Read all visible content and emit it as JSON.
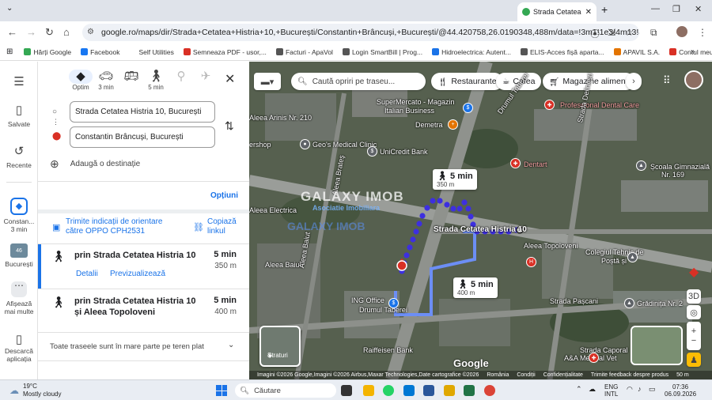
{
  "browser": {
    "tab_title": "Strada Cetatea Hi",
    "url": "google.ro/maps/dir/Strada+Cetatea+Histria+10,+București/Constantin+Brâncuși,+București/@44.420758,26.0190348,488m/data=!3m1!1e3!4m13!4",
    "bookmarks": [
      {
        "label": "Hărți Google",
        "color": "#34a853"
      },
      {
        "label": "Facebook",
        "color": "#1877f2"
      },
      {
        "label": "Self Utilities",
        "color": "#ffffff"
      },
      {
        "label": "Semneaza PDF - usor,...",
        "color": "#d93025"
      },
      {
        "label": "Facturi - ApaVol",
        "color": "#555555"
      },
      {
        "label": "Login SmartBill | Prog...",
        "color": "#555555"
      },
      {
        "label": "Hidroelectrica: Autent...",
        "color": "#1a73e8"
      },
      {
        "label": "ELIS-Acces fișă aparta...",
        "color": "#555555"
      },
      {
        "label": "APAVIL S.A.",
        "color": "#e37400"
      },
      {
        "label": "Contul meu",
        "color": "#d93025"
      }
    ]
  },
  "rail": {
    "menu_icon": "menu-icon",
    "saved": "Salvate",
    "recent": "Recente",
    "current_label": "Constan...",
    "current_time": "3 min",
    "city_thumb_num": "46",
    "city": "București",
    "more": "Afișează mai multe",
    "download": "Descarcă aplicația"
  },
  "modes": {
    "best": "Optim",
    "car_time": "3 min",
    "walk_time": "5 min"
  },
  "directions": {
    "origin": "Strada Cetatea Histria 10, București",
    "destination": "Constantin Brâncuși, București",
    "add_destination": "Adaugă o destinație",
    "options": "Opțiuni",
    "send_to_phone": "Trimite indicații de orientare către OPPO CPH2531",
    "copy_link": "Copiază linkul",
    "routes": [
      {
        "name": "prin Strada Cetatea Histria 10",
        "time": "5 min",
        "distance": "350 m",
        "details": "Detalii",
        "preview": "Previzualizează"
      },
      {
        "name": "prin Strada Cetatea Histria 10 și Aleea Topoloveni",
        "time": "5 min",
        "distance": "400 m"
      }
    ],
    "all_routes_note": "Toate traseele sunt în mare parte pe teren plat"
  },
  "map": {
    "search_placeholder": "Caută opriri pe traseu...",
    "chips": [
      "Restaurante",
      "Cafea",
      "Magazine alimentar"
    ],
    "callout1": {
      "time": "5 min",
      "dist": "350 m"
    },
    "callout2": {
      "time": "5 min",
      "dist": "400 m"
    },
    "labels": [
      "SuperMercato - Magazin",
      "Italian Business",
      "Demetra",
      "Professional Dental Care",
      "Aleea Arinis Nr. 210",
      "Geo's Medical Clinic",
      "UniCredit Bank",
      "Drumul Taberei",
      "Strada Delineşti",
      "Dentart",
      "Școala Gimnazială",
      "Nr. 169",
      "Aleea Electrica",
      "Strada Cetatea Histria 10",
      "Aleea Topoloveni",
      "Colegiul Tehnic de",
      "Poștă și",
      "Aleea Baiut",
      "ING Office",
      "Drumul Taberei",
      "Strada Pașcani",
      "Grădinița Nr. 2",
      "Raiffeisen Bank",
      "A&A Medical Vet",
      "Strada Caporal",
      "Straturi",
      "3D",
      "ershop",
      "Aleea Baiut",
      "Aleea Brateş"
    ],
    "watermark": "GALAXY IMOB",
    "watermark_sub": "Asociatie Imobiliara",
    "watermark_faint": "GALAXY IMOB",
    "google": "Google",
    "attribution": [
      "Imagini ©2026 Google,Imagini ©2026 Airbus,Maxar Technologies,Date cartografice ©2026",
      "România",
      "Condiții",
      "Confidențialitate",
      "Trimite feedback despre produs",
      "50 m"
    ]
  },
  "taskbar": {
    "temp": "19°C",
    "weather": "Mostly cloudy",
    "search": "Căutare",
    "lang1": "ENG",
    "lang2": "INTL",
    "time": "07:36",
    "date": "06.09.2026"
  }
}
